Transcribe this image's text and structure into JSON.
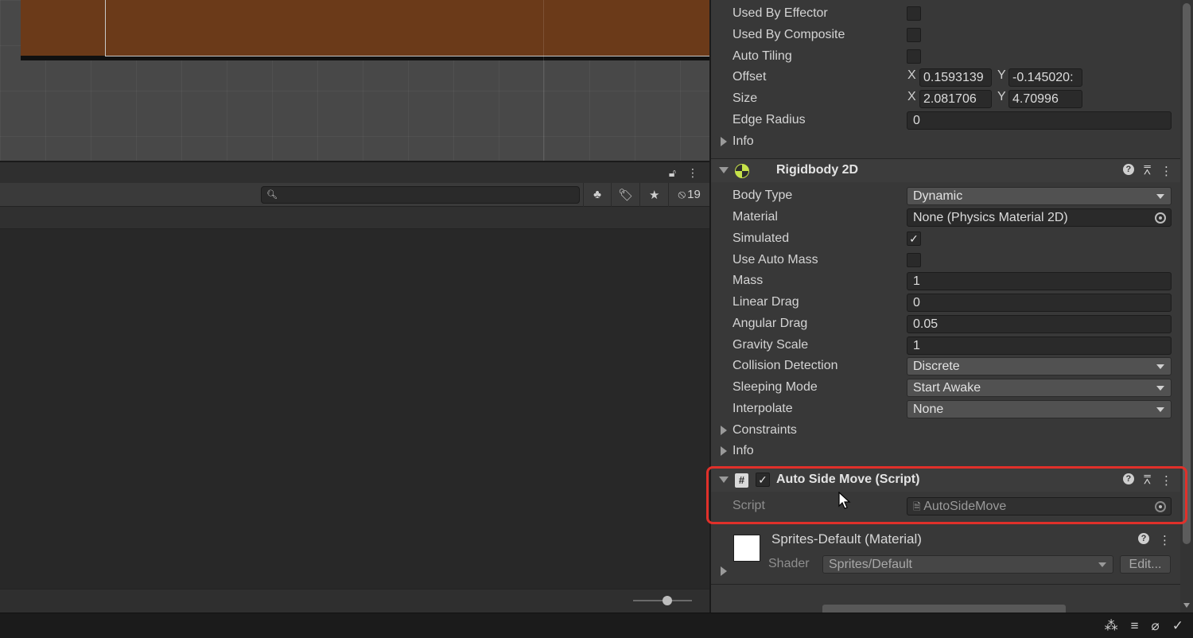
{
  "lower_panel": {
    "search_placeholder": "",
    "hidden_count": "19"
  },
  "inspector": {
    "collider_rows": {
      "used_by_effector": "Used By Effector",
      "used_by_composite": "Used By Composite",
      "auto_tiling": "Auto Tiling",
      "offset_label": "Offset",
      "offset_x_label": "X",
      "offset_x": "0.1593139",
      "offset_y_label": "Y",
      "offset_y": "-0.145020:",
      "size_label": "Size",
      "size_x_label": "X",
      "size_x": "2.081706",
      "size_y_label": "Y",
      "size_y": "4.70996",
      "edge_radius_label": "Edge Radius",
      "edge_radius": "0",
      "info_label": "Info"
    },
    "rigidbody": {
      "title": "Rigidbody 2D",
      "body_type_label": "Body Type",
      "body_type": "Dynamic",
      "material_label": "Material",
      "material": "None (Physics Material 2D)",
      "simulated_label": "Simulated",
      "use_auto_mass_label": "Use Auto Mass",
      "mass_label": "Mass",
      "mass": "1",
      "linear_drag_label": "Linear Drag",
      "linear_drag": "0",
      "angular_drag_label": "Angular Drag",
      "angular_drag": "0.05",
      "gravity_scale_label": "Gravity Scale",
      "gravity_scale": "1",
      "collision_detection_label": "Collision Detection",
      "collision_detection": "Discrete",
      "sleeping_mode_label": "Sleeping Mode",
      "sleeping_mode": "Start Awake",
      "interpolate_label": "Interpolate",
      "interpolate": "None",
      "constraints_label": "Constraints",
      "info_label": "Info"
    },
    "script_component": {
      "title": "Auto Side Move (Script)",
      "script_label": "Script",
      "script_value": "AutoSideMove",
      "highlight_color": "#e0302a"
    },
    "material": {
      "title": "Sprites-Default (Material)",
      "shader_label": "Shader",
      "shader_value": "Sprites/Default",
      "edit_label": "Edit..."
    }
  },
  "icons": {
    "lock": "lock-icon",
    "kebab": "kebab-menu-icon",
    "help": "help-icon",
    "presets": "presets-icon",
    "checkmark": "✓"
  },
  "colors": {
    "scene_sprite": "#6b3a19",
    "rigidbody_icon": "#c6e24a",
    "highlight": "#e0302a"
  }
}
